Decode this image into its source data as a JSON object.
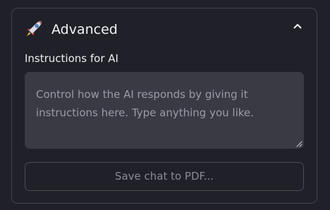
{
  "advanced_section": {
    "icon": "rocket-icon",
    "title": "Advanced",
    "expanded": true,
    "collapse_icon": "chevron-up-icon"
  },
  "instructions": {
    "label": "Instructions for AI",
    "value": "",
    "placeholder": "Control how the AI responds by giving it instructions here. Type anything you like."
  },
  "actions": {
    "save_pdf_label": "Save chat to PDF..."
  },
  "colors": {
    "background": "#202028",
    "border": "#43434d",
    "textarea_bg": "#3a3a45",
    "text_primary": "#f2f2f5",
    "text_placeholder": "#9b9ba6",
    "button_text_disabled": "#8a8a94"
  }
}
